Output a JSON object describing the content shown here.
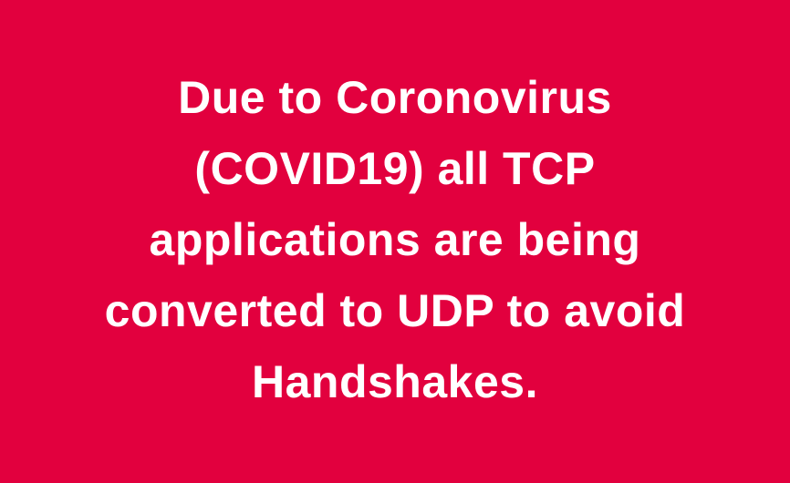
{
  "background_color": "#e2003e",
  "text_color": "#ffffff",
  "message": {
    "lines": [
      "Due to Coronovirus",
      "(COVID19) all TCP",
      "applications are being",
      "converted to UDP to avoid",
      "Handshakes."
    ]
  }
}
